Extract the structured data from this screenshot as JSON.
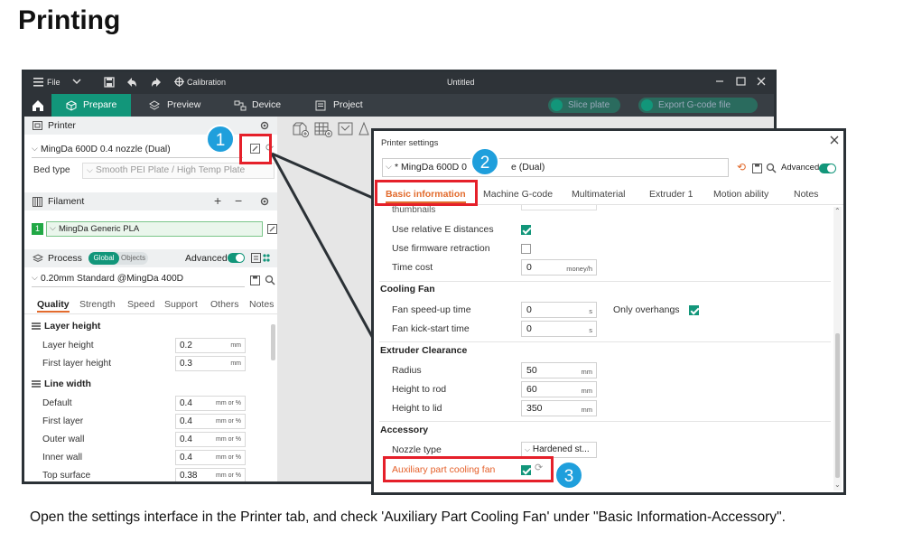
{
  "doc": {
    "title": "Printing",
    "caption": "Open the settings interface in the Printer tab, and check 'Auxiliary Part Cooling Fan' under \"Basic Information-Accessory\"."
  },
  "app": {
    "file_menu": "File",
    "calibration": "Calibration",
    "window_title": "Untitled",
    "tabs": [
      "Prepare",
      "Preview",
      "Device",
      "Project"
    ],
    "slice_button": "Slice plate",
    "export_button": "Export G-code file"
  },
  "left": {
    "printer_header": "Printer",
    "printer_name": "MingDa 600D 0.4 nozzle (Dual)",
    "bed_type_label": "Bed type",
    "bed_type_value": "Smooth PEI Plate / High Temp Plate",
    "filament_header": "Filament",
    "filament_index": "1",
    "filament_name": "MingDa Generic PLA",
    "process_header": "Process",
    "global_label": "Global",
    "objects_label": "Objects",
    "advanced_label": "Advanced",
    "process_preset": "0.20mm Standard @MingDa 400D",
    "sub_tabs": [
      "Quality",
      "Strength",
      "Speed",
      "Support",
      "Others",
      "Notes"
    ],
    "layer_height_header": "Layer height",
    "layer_height_label": "Layer height",
    "layer_height_value": "0.2",
    "first_layer_height_label": "First layer height",
    "first_layer_height_value": "0.3",
    "mm_unit": "mm",
    "line_width_header": "Line width",
    "line_widths": [
      {
        "label": "Default",
        "value": "0.4"
      },
      {
        "label": "First layer",
        "value": "0.4"
      },
      {
        "label": "Outer wall",
        "value": "0.4"
      },
      {
        "label": "Inner wall",
        "value": "0.4"
      },
      {
        "label": "Top surface",
        "value": "0.38"
      }
    ],
    "mm_or_pct_unit": "mm or %"
  },
  "dialog": {
    "title": "Printer settings",
    "preset": "* MingDa 600D 0.4 nozzle (Dual)",
    "preset_visible_left": "* MingDa 600D 0",
    "preset_visible_right": "e (Dual)",
    "advanced_label": "Advanced",
    "tabs": [
      "Basic information",
      "Machine G-code",
      "Multimaterial",
      "Extruder 1",
      "Motion ability",
      "Notes"
    ],
    "thumbnails_label": "thumbnails",
    "use_relative_e": "Use relative E distances",
    "use_relative_e_checked": true,
    "use_firmware_retraction": "Use firmware retraction",
    "use_firmware_retraction_checked": false,
    "time_cost_label": "Time cost",
    "time_cost_value": "0",
    "time_cost_unit": "money/h",
    "cooling_fan_header": "Cooling Fan",
    "fan_speedup_label": "Fan speed-up time",
    "fan_speedup_value": "0",
    "s_unit": "s",
    "only_overhangs_label": "Only overhangs",
    "only_overhangs_checked": true,
    "fan_kickstart_label": "Fan kick-start time",
    "fan_kickstart_value": "0",
    "extruder_clearance_header": "Extruder Clearance",
    "radius_label": "Radius",
    "radius_value": "50",
    "height_rod_label": "Height to rod",
    "height_rod_value": "60",
    "height_lid_label": "Height to lid",
    "height_lid_value": "350",
    "mm_unit": "mm",
    "accessory_header": "Accessory",
    "nozzle_type_label": "Nozzle type",
    "nozzle_type_value": "Hardened st...",
    "aux_fan_label": "Auxiliary part cooling fan",
    "aux_fan_checked": true
  },
  "callouts": [
    "1",
    "2",
    "3"
  ],
  "colors": {
    "accent": "#12967a",
    "highlight": "#e5202a",
    "badge": "#1f9fdc",
    "titlebar": "#2e3338"
  }
}
